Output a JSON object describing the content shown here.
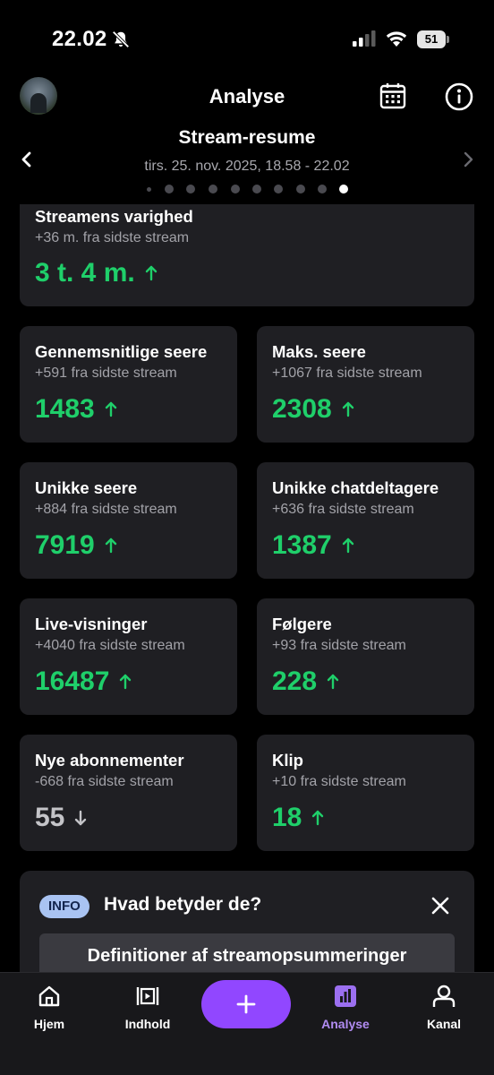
{
  "status_bar": {
    "time": "22.02",
    "battery": "51"
  },
  "header": {
    "title": "Analyse"
  },
  "summary": {
    "title": "Stream-resume",
    "date": "tirs. 25. nov. 2025, 18.58 - 22.02",
    "page_count": 10,
    "active_page": 10
  },
  "stats": {
    "duration": {
      "label": "Streamens varighed",
      "change": "+36 m. fra sidste stream",
      "value": "3 t. 4 m.",
      "trend": "up"
    },
    "avg_viewers": {
      "label": "Gennemsnitlige seere",
      "change": "+591 fra sidste stream",
      "value": "1483",
      "trend": "up"
    },
    "max_viewers": {
      "label": "Maks. seere",
      "change": "+1067 fra sidste stream",
      "value": "2308",
      "trend": "up"
    },
    "unique_viewers": {
      "label": "Unikke seere",
      "change": "+884 fra sidste stream",
      "value": "7919",
      "trend": "up"
    },
    "unique_chatters": {
      "label": "Unikke chatdeltagere",
      "change": "+636 fra sidste stream",
      "value": "1387",
      "trend": "up"
    },
    "live_views": {
      "label": "Live-visninger",
      "change": "+4040 fra sidste stream",
      "value": "16487",
      "trend": "up"
    },
    "followers": {
      "label": "Følgere",
      "change": "+93 fra sidste stream",
      "value": "228",
      "trend": "up"
    },
    "new_subs": {
      "label": "Nye abonnementer",
      "change": "-668 fra sidste stream",
      "value": "55",
      "trend": "down"
    },
    "clips": {
      "label": "Klip",
      "change": "+10 fra sidste stream",
      "value": "18",
      "trend": "up"
    }
  },
  "info_panel": {
    "badge": "INFO",
    "title": "Hvad betyder de?",
    "button": "Definitioner af streamopsummeringer"
  },
  "tabs": [
    {
      "label": "Hjem",
      "icon": "home-icon"
    },
    {
      "label": "Indhold",
      "icon": "content-icon"
    },
    {
      "label": "",
      "icon": "plus-icon"
    },
    {
      "label": "Analyse",
      "icon": "analytics-icon"
    },
    {
      "label": "Kanal",
      "icon": "profile-icon"
    }
  ],
  "colors": {
    "background": "#000000",
    "card": "#1f1f23",
    "positive": "#1fcf6a",
    "accent": "#9147ff",
    "active_tab": "#b18cf2"
  }
}
